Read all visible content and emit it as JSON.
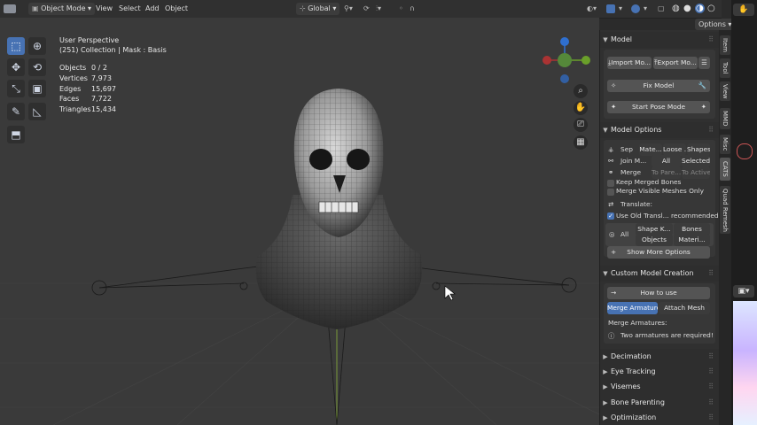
{
  "header": {
    "mode": "Object Mode",
    "menu": [
      "View",
      "Select",
      "Add",
      "Object"
    ],
    "orientation": "Global",
    "options_label": "Options"
  },
  "viewport": {
    "view_name": "User Perspective",
    "collection_info": "(251) Collection | Mask : Basis",
    "stats": [
      {
        "label": "Objects",
        "value": "0 / 2"
      },
      {
        "label": "Vertices",
        "value": "7,973"
      },
      {
        "label": "Edges",
        "value": "15,697"
      },
      {
        "label": "Faces",
        "value": "7,722"
      },
      {
        "label": "Triangles",
        "value": "15,434"
      }
    ]
  },
  "panel": {
    "model_header": "Model",
    "import_label": "Import Mo...",
    "export_label": "Export Mo...",
    "fix_model": "Fix Model",
    "start_pose": "Start Pose Mode",
    "model_options_header": "Model Options",
    "sep_label": "Sep",
    "sep_opts": [
      "Mate...",
      "Loose ...",
      "Shapes"
    ],
    "join_label": "Join M...",
    "join_opts": [
      "All",
      "Selected"
    ],
    "merge_label": "Merge",
    "merge_opts": [
      "To Pare...",
      "To Active"
    ],
    "keep_merged": "Keep Merged Bones",
    "merge_visible": "Merge Visible Meshes Only",
    "translate_label": "Translate:",
    "use_old_transl": "Use Old Transl... recommended)",
    "all_label": "All",
    "translate_opts": [
      "Shape K...",
      "Bones",
      "Objects",
      "Materi..."
    ],
    "show_more": "Show More Options",
    "custom_header": "Custom Model Creation",
    "how_to_use": "How to use",
    "merge_armatures": "Merge Armatures",
    "attach_mesh": "Attach Mesh",
    "merge_armatures_lbl": "Merge Armatures:",
    "warning": "Two armatures are required!",
    "collapsed": [
      "Decimation",
      "Eye Tracking",
      "Visemes",
      "Bone Parenting",
      "Optimization"
    ]
  },
  "tabs": [
    "Item",
    "Tool",
    "View",
    "MMD",
    "Misc",
    "CATS",
    "Quad Remesh"
  ],
  "colors": {
    "accent": "#4772b3",
    "bg": "#303030",
    "viewport": "#3a3a3a"
  }
}
